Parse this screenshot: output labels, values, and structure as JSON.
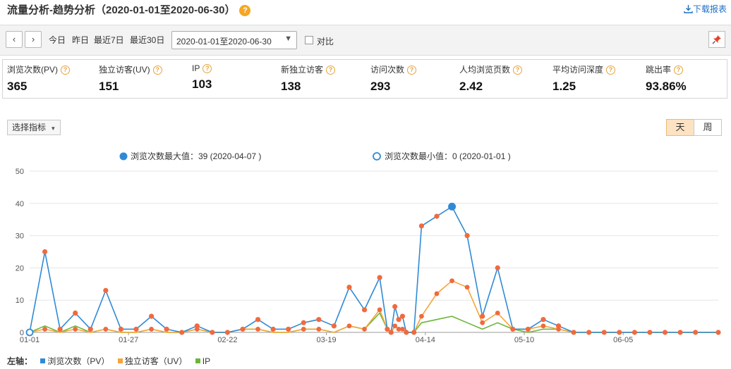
{
  "header": {
    "title": "流量分析-趋势分析（2020-01-01至2020-06-30）",
    "help_glyph": "?",
    "download_label": "下载报表"
  },
  "toolbar": {
    "prev_glyph": "‹",
    "next_glyph": "›",
    "presets": [
      "今日",
      "昨日",
      "最近7日",
      "最近30日"
    ],
    "date_range": "2020-01-01至2020-06-30",
    "compare_label": "对比",
    "pin_glyph": "📌"
  },
  "metrics": [
    {
      "label": "浏览次数(PV)",
      "value": "365"
    },
    {
      "label": "独立访客(UV)",
      "value": "151"
    },
    {
      "label": "IP",
      "value": "103"
    },
    {
      "label": "新独立访客",
      "value": "138"
    },
    {
      "label": "访问次数",
      "value": "293"
    },
    {
      "label": "人均浏览页数",
      "value": "2.42"
    },
    {
      "label": "平均访问深度",
      "value": "1.25"
    },
    {
      "label": "跳出率",
      "value": "93.86%"
    }
  ],
  "controls": {
    "select_metric_label": "选择指标",
    "granularity": [
      "天",
      "周"
    ],
    "active_granularity": "天"
  },
  "chart_data": {
    "type": "line",
    "x": [
      "01-01",
      "01-05",
      "01-09",
      "01-13",
      "01-17",
      "01-21",
      "01-25",
      "01-29",
      "02-02",
      "02-06",
      "02-10",
      "02-14",
      "02-18",
      "02-22",
      "02-26",
      "03-01",
      "03-05",
      "03-09",
      "03-13",
      "03-17",
      "03-21",
      "03-25",
      "03-29",
      "04-02",
      "04-04",
      "04-05",
      "04-06",
      "04-07",
      "04-08",
      "04-09",
      "04-11",
      "04-13",
      "04-17",
      "04-21",
      "04-25",
      "04-29",
      "05-03",
      "05-07",
      "05-11",
      "05-15",
      "05-19",
      "05-23",
      "05-27",
      "05-31",
      "06-04",
      "06-08",
      "06-12",
      "06-16",
      "06-20",
      "06-24",
      "06-30"
    ],
    "xticks": [
      "01-01",
      "01-27",
      "02-22",
      "03-19",
      "04-14",
      "05-10",
      "06-05"
    ],
    "ylim": [
      0,
      50
    ],
    "yticks": [
      0,
      10,
      20,
      30,
      40,
      50
    ],
    "series": [
      {
        "name": "浏览次数（PV）",
        "color": "#2f8ad6",
        "values": [
          0,
          25,
          1,
          6,
          1,
          13,
          1,
          1,
          5,
          1,
          0,
          2,
          0,
          0,
          1,
          4,
          1,
          1,
          3,
          4,
          2,
          14,
          7,
          17,
          1,
          0,
          8,
          4,
          5,
          0,
          0,
          33,
          36,
          39,
          30,
          5,
          20,
          1,
          1,
          4,
          2,
          0,
          0,
          0,
          0,
          0,
          0,
          0,
          0,
          0,
          0
        ]
      },
      {
        "name": "独立访客（UV）",
        "color": "#f5a53b",
        "values": [
          0,
          1,
          0,
          1,
          0,
          1,
          0,
          0,
          1,
          0,
          0,
          1,
          0,
          0,
          1,
          1,
          0,
          0,
          1,
          1,
          0,
          2,
          1,
          7,
          1,
          0,
          2,
          1,
          1,
          0,
          0,
          5,
          12,
          16,
          14,
          3,
          6,
          1,
          1,
          2,
          1,
          0,
          0,
          0,
          0,
          0,
          0,
          0,
          0,
          0,
          0
        ]
      },
      {
        "name": "IP",
        "color": "#6cb53a",
        "values": [
          0,
          2,
          0,
          2,
          0,
          1,
          0,
          0,
          1,
          0,
          0,
          1,
          0,
          0,
          1,
          1,
          0,
          0,
          1,
          1,
          0,
          2,
          1,
          6,
          1,
          0,
          2,
          1,
          1,
          0,
          0,
          3,
          4,
          5,
          3,
          1,
          3,
          1,
          0,
          1,
          1,
          0,
          0,
          0,
          0,
          0,
          0,
          0,
          0,
          0,
          0
        ]
      }
    ],
    "max_label": "浏览次数最大值：39 (2020-04-07 )",
    "min_label": "浏览次数最小值：0 (2020-01-01 )",
    "axis_prefix": "左轴："
  }
}
